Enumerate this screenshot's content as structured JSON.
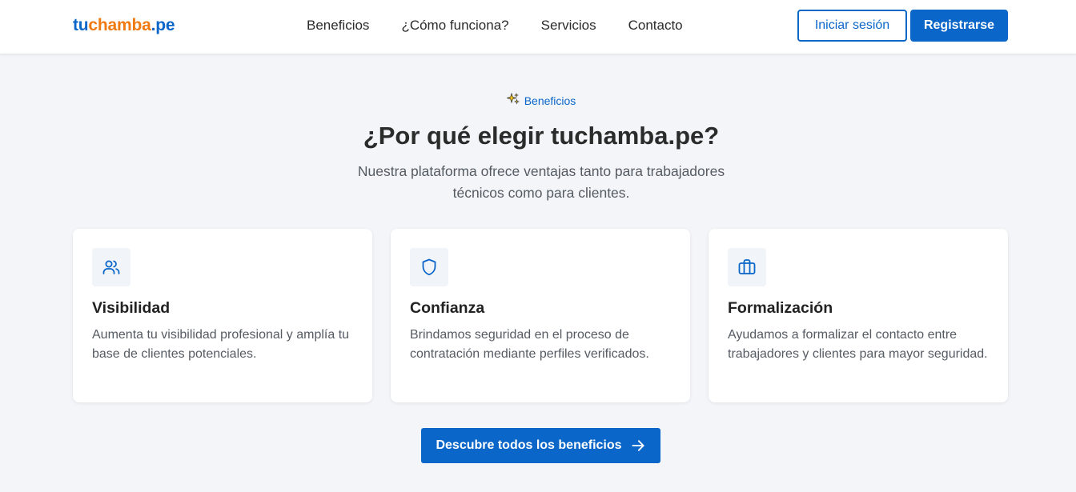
{
  "brand": {
    "part1": "tu",
    "part2": "chamba",
    "part3": ".pe"
  },
  "nav": {
    "links": [
      "Beneficios",
      "¿Cómo funciona?",
      "Servicios",
      "Contacto"
    ],
    "login_label": "Iniciar sesión",
    "register_label": "Registrarse"
  },
  "section": {
    "tag_icon": "sparkle-icon",
    "tag": "Beneficios",
    "headline": "¿Por qué elegir tuchamba.pe?",
    "subtitle": "Nuestra plataforma ofrece ventajas tanto para trabajadores técnicos como para clientes."
  },
  "cards": [
    {
      "icon": "users-icon",
      "title": "Visibilidad",
      "text": "Aumenta tu visibilidad profesional y amplía tu base de clientes potenciales."
    },
    {
      "icon": "shield-icon",
      "title": "Confianza",
      "text": "Brindamos seguridad en el proceso de contratación mediante perfiles verificados."
    },
    {
      "icon": "briefcase-icon",
      "title": "Formalización",
      "text": "Ayudamos a formalizar el contacto entre trabajadores y clientes para mayor seguridad."
    }
  ],
  "cta": {
    "label": "Descubre todos los beneficios",
    "icon": "arrow-right-icon"
  },
  "colors": {
    "primary": "#0a66c8",
    "brand_orange": "#f07a12",
    "page_bg": "#f3f5f9",
    "text_dark": "#2b2b2b",
    "text_muted": "#555b63"
  }
}
